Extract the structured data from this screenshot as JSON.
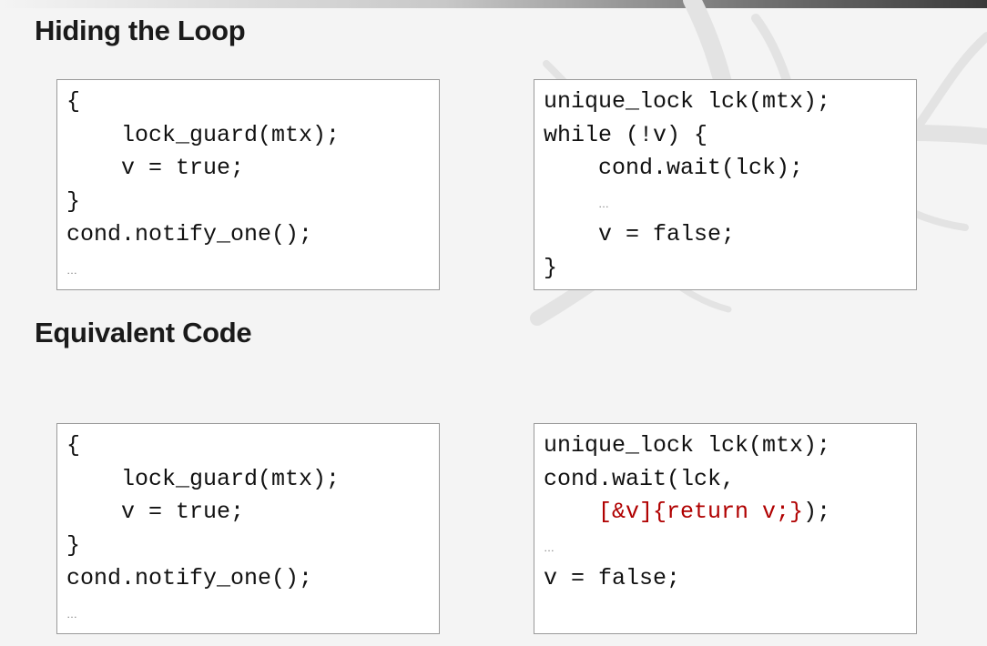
{
  "sections": [
    {
      "title": "Hiding the Loop"
    },
    {
      "title": "Equivalent Code"
    }
  ],
  "code_blocks": {
    "top_left": [
      {
        "indent": "",
        "text": "{"
      },
      {
        "indent": "    ",
        "text": "lock_guard(mtx);"
      },
      {
        "indent": "    ",
        "text": "v = true;"
      },
      {
        "indent": "",
        "text": "}"
      },
      {
        "indent": "",
        "text": "cond.notify_one();"
      },
      {
        "indent": "",
        "text": "…",
        "ellipsis": true
      }
    ],
    "top_right": [
      {
        "indent": "",
        "text": "unique_lock lck(mtx);"
      },
      {
        "indent": "",
        "text": "while (!v) {"
      },
      {
        "indent": "    ",
        "text": "cond.wait(lck);"
      },
      {
        "indent": "    ",
        "text": "…",
        "ellipsis": true
      },
      {
        "indent": "    ",
        "text": "v = false;"
      },
      {
        "indent": "",
        "text": "}"
      }
    ],
    "bottom_left": [
      {
        "indent": "",
        "text": "{"
      },
      {
        "indent": "    ",
        "text": "lock_guard(mtx);"
      },
      {
        "indent": "    ",
        "text": "v = true;"
      },
      {
        "indent": "",
        "text": "}"
      },
      {
        "indent": "",
        "text": "cond.notify_one();"
      },
      {
        "indent": "",
        "text": "…",
        "ellipsis": true
      }
    ],
    "bottom_right": [
      {
        "indent": "",
        "text": "unique_lock lck(mtx);"
      },
      {
        "indent": "",
        "text": "cond.wait(lck,"
      },
      {
        "indent": "    ",
        "text": "[&v]{return v;}",
        "after": ");",
        "highlight": true
      },
      {
        "indent": "",
        "text": "…",
        "ellipsis": true
      },
      {
        "indent": "",
        "text": "v = false;"
      }
    ]
  },
  "colors": {
    "lambda_highlight": "#b00000",
    "background": "#f4f4f4",
    "box_border": "#9a9a9a"
  }
}
